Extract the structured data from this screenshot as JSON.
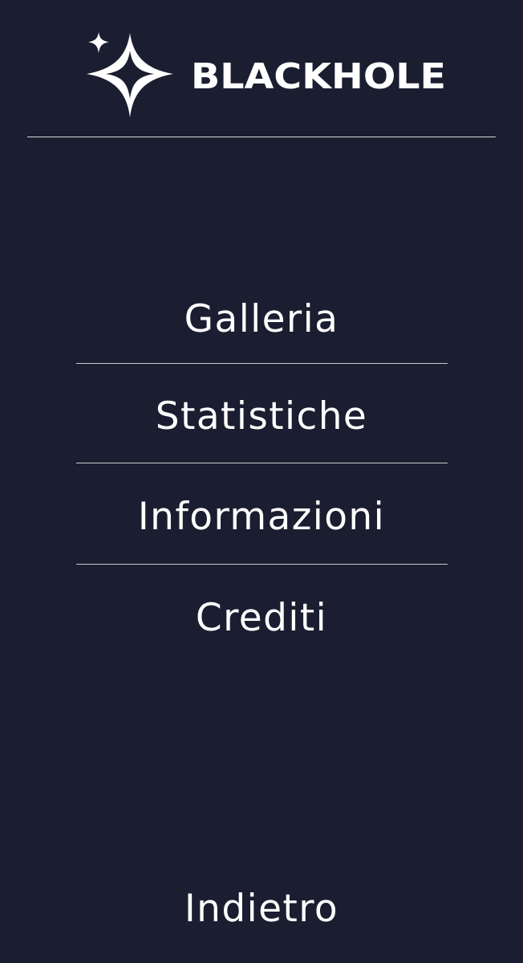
{
  "brand": {
    "name": "BLACKHOLE",
    "icon": "sparkle-star-icon",
    "accent": "#ffffff",
    "background": "#1b1d30"
  },
  "menu": {
    "items": [
      {
        "label": "Galleria"
      },
      {
        "label": "Statistiche"
      },
      {
        "label": "Informazioni"
      },
      {
        "label": "Crediti"
      }
    ],
    "back_label": "Indietro"
  }
}
